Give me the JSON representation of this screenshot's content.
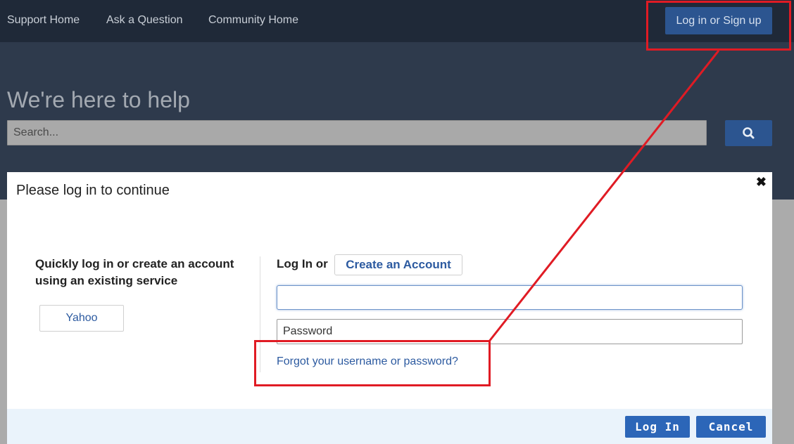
{
  "nav": {
    "support_home": "Support Home",
    "ask_question": "Ask a Question",
    "community_home": "Community Home",
    "login_signup": "Log in or Sign up"
  },
  "hero": {
    "title": "We're here to help",
    "search_placeholder": "Search...",
    "search_icon": "search-icon"
  },
  "modal": {
    "title": "Please log in to continue",
    "close_icon": "close-icon",
    "close_glyph": "✖",
    "left_heading": "Quickly log in or create an account using an existing service",
    "yahoo_label": "Yahoo",
    "login_label": "Log In or",
    "create_account_label": "Create an Account",
    "username_value": "",
    "password_placeholder": "Password",
    "forgot_link": "Forgot your username or password?",
    "login_button": "Log In",
    "cancel_button": "Cancel"
  },
  "colors": {
    "nav_bg": "#1f2938",
    "hero_bg": "#2e3a4c",
    "accent": "#2c5590",
    "annotation": "#e01b24"
  }
}
